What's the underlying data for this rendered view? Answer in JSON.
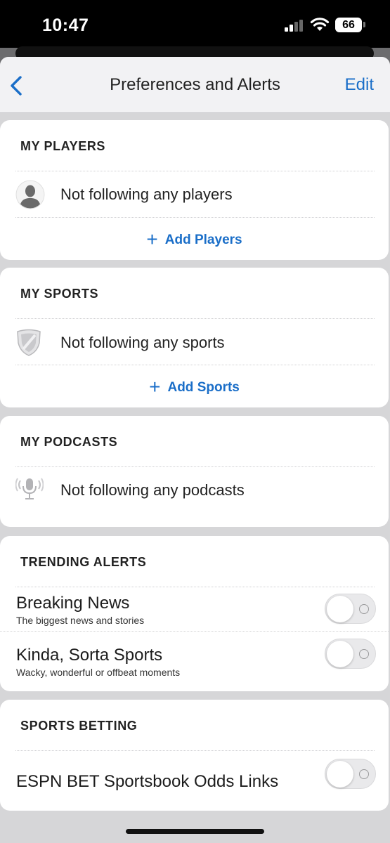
{
  "status_bar": {
    "time": "10:47",
    "battery": "66",
    "icons": [
      "signal-icon",
      "wifi-icon",
      "battery-icon"
    ]
  },
  "nav": {
    "title": "Preferences and Alerts",
    "edit_label": "Edit",
    "back_icon": "chevron-left-icon"
  },
  "players": {
    "header": "MY PLAYERS",
    "empty_text": "Not following any players",
    "add_label": "Add Players",
    "icon": "player-silhouette-icon"
  },
  "sports": {
    "header": "MY SPORTS",
    "empty_text": "Not following any sports",
    "add_label": "Add Sports",
    "icon": "shield-icon"
  },
  "podcasts": {
    "header": "MY PODCASTS",
    "empty_text": "Not following any podcasts",
    "icon": "podcast-microphone-icon"
  },
  "trending": {
    "header": "TRENDING ALERTS",
    "items": [
      {
        "title": "Breaking News",
        "subtitle": "The biggest news and stories",
        "enabled": false
      },
      {
        "title": "Kinda, Sorta Sports",
        "subtitle": "Wacky, wonderful or offbeat moments",
        "enabled": false
      }
    ]
  },
  "betting": {
    "header": "SPORTS BETTING",
    "items": [
      {
        "title": "ESPN BET Sportsbook Odds Links",
        "enabled": false
      }
    ]
  },
  "colors": {
    "accent": "#1a6ec8",
    "toggle_off": "#e9e9eb",
    "sheet_background": "#d6d6d8"
  }
}
